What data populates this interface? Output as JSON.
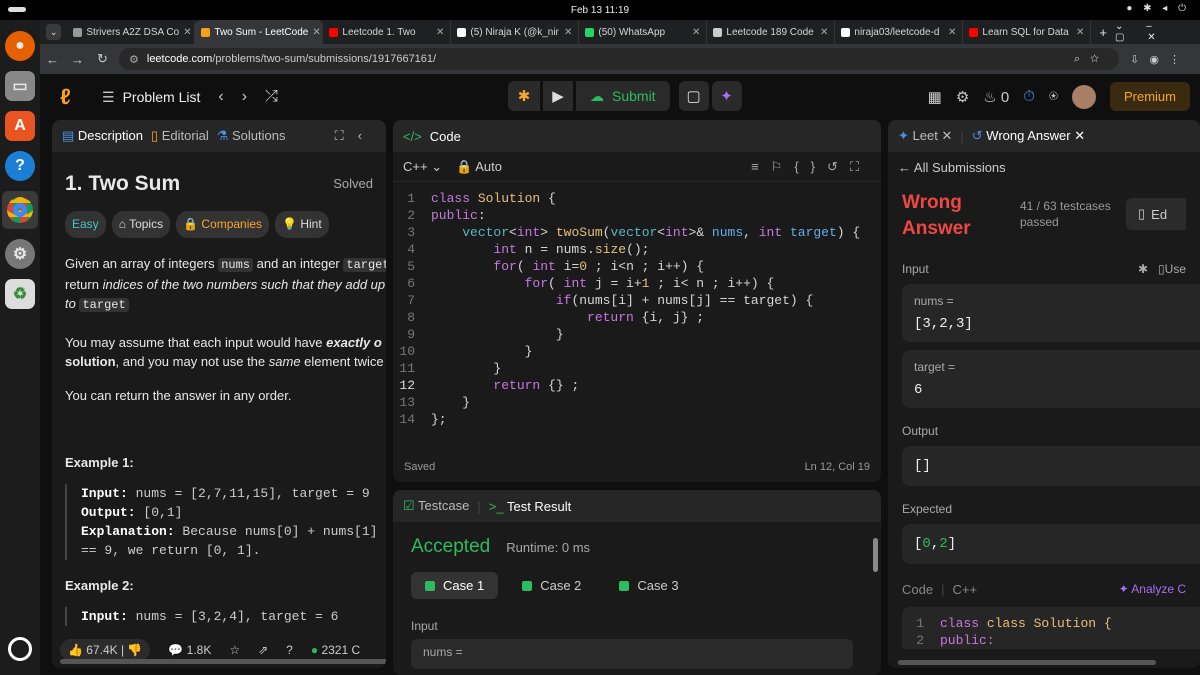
{
  "system": {
    "clock": "Feb 13  11:19",
    "tray": "● ✱ ◂ ⏻"
  },
  "tabs": [
    {
      "label": "Strivers A2Z DSA Co",
      "color": "#999"
    },
    {
      "label": "Two Sum - LeetCode",
      "color": "#f89f1b"
    },
    {
      "label": "Leetcode 1. Two",
      "color": "#ff0000"
    },
    {
      "label": "(5) Niraja K (@k_nir",
      "color": "#ffffff"
    },
    {
      "label": "(50) WhatsApp",
      "color": "#25d366"
    },
    {
      "label": "Leetcode 189 Code",
      "color": "#cccccc"
    },
    {
      "label": "niraja03/leetcode-d",
      "color": "#ffffff"
    },
    {
      "label": "Learn SQL for Data",
      "color": "#ff0000"
    }
  ],
  "address": {
    "domain": "leetcode.com",
    "path": "/problems/two-sum/submissions/1917667161/"
  },
  "header": {
    "problem_list": "Problem List",
    "submit": "Submit",
    "streak": "0",
    "premium": "Premium"
  },
  "description": {
    "tabs": [
      "Description",
      "Editorial",
      "Solutions"
    ],
    "title": "1. Two Sum",
    "solved": "Solved",
    "chips": [
      "Easy",
      "Topics",
      "Companies",
      "Hint"
    ],
    "p1a": "Given an array of integers ",
    "p1code": "nums",
    "p1b": " and an integer ",
    "p1code2": "target",
    "p1c": "return ",
    "p1d": "indices of the two numbers such that they add up",
    "p1e": "to ",
    "p1code3": "target",
    "p2a": "You may assume that each input would have ",
    "p2b": "exactly o",
    "p2c": "solution",
    "p2d": ", and you may not use the ",
    "p2e": "same",
    "p2f": " element twice",
    "p3": "You can return the answer in any order.",
    "ex1_title": "Example 1:",
    "ex1_in_label": "Input:",
    "ex1_in": " nums = [2,7,11,15], target = 9",
    "ex1_out_label": "Output:",
    "ex1_out": " [0,1]",
    "ex1_exp_label": "Explanation:",
    "ex1_exp": " Because nums[0] + nums[1]",
    "ex1_exp2": "== 9, we return [0, 1].",
    "ex2_title": "Example 2:",
    "ex2_in_label": "Input:",
    "ex2_in": " nums = [3,2,4], target = 6",
    "likes": "67.4K",
    "comments": "1.8K",
    "online": "2321 C"
  },
  "editor": {
    "title": "Code",
    "lang": "C++",
    "mode": "Auto",
    "status": "Saved",
    "position": "Ln 12, Col 19"
  },
  "result": {
    "tab1": "Testcase",
    "tab2": "Test Result",
    "verdict": "Accepted",
    "runtime": "Runtime: 0 ms",
    "cases": [
      "Case 1",
      "Case 2",
      "Case 3"
    ],
    "input_label": "Input",
    "input_preview": "nums ="
  },
  "submission": {
    "tab1": "Leet",
    "tab2": "Wrong Answer",
    "back": "All Submissions",
    "verdict1": "Wrong",
    "verdict2": "Answer",
    "count": "41 / 63 testcases",
    "passed": "passed",
    "editorial": "Ed",
    "input_label": "Input",
    "use": "Use",
    "nums_label": "nums =",
    "nums_val": "[3,2,3]",
    "target_label": "target =",
    "target_val": "6",
    "output_label": "Output",
    "output_val": "[]",
    "expected_label": "Expected",
    "expected_val": "[0,2]",
    "code_label": "Code",
    "code_lang": "C++",
    "analyze": "Analyze C",
    "mini1": "class Solution {",
    "mini2": "public:"
  }
}
